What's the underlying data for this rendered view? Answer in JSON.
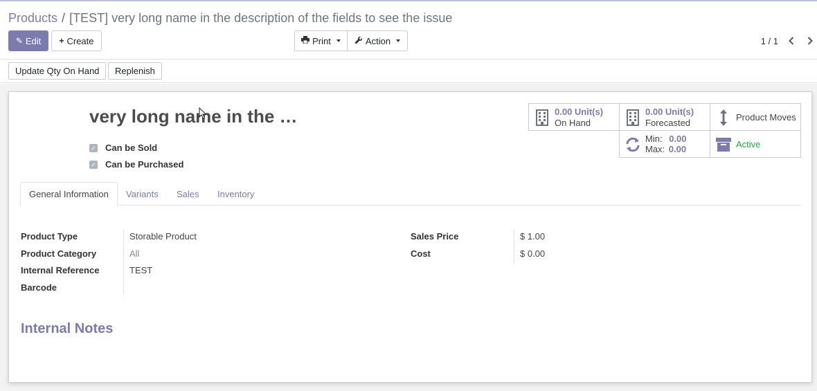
{
  "breadcrumb": {
    "parent": "Products",
    "separator": "/",
    "current": "[TEST] very long name in the description of the fields to see the issue"
  },
  "toolbar": {
    "edit_label": "Edit",
    "create_label": "Create",
    "print_label": "Print",
    "action_label": "Action"
  },
  "pager": {
    "value": "1 / 1"
  },
  "statusbar": {
    "update_qty_label": "Update Qty On Hand",
    "replenish_label": "Replenish"
  },
  "product": {
    "name": "very long name in the …",
    "can_be_sold": "Can be Sold",
    "can_be_purchased": "Can be Purchased"
  },
  "smart_buttons": {
    "on_hand": {
      "value": "0.00 Unit(s)",
      "label": "On Hand",
      "icon": "building-icon"
    },
    "forecasted": {
      "value": "0.00 Unit(s)",
      "label": "Forecasted",
      "icon": "building-icon"
    },
    "product_moves": {
      "label": "Product Moves",
      "icon": "arrows-v-icon"
    },
    "reorder": {
      "min_label": "Min:",
      "min_value": "0.00",
      "max_label": "Max:",
      "max_value": "0.00",
      "icon": "refresh-icon"
    },
    "active": {
      "label": "Active",
      "icon": "archive-icon"
    }
  },
  "tabs": [
    "General Information",
    "Variants",
    "Sales",
    "Inventory"
  ],
  "fields_left": [
    {
      "label": "Product Type",
      "value": "Storable Product"
    },
    {
      "label": "Product Category",
      "value": "All"
    },
    {
      "label": "Internal Reference",
      "value": "TEST"
    },
    {
      "label": "Barcode",
      "value": ""
    }
  ],
  "fields_right": [
    {
      "label": "Sales Price",
      "value": "$ 1.00"
    },
    {
      "label": "Cost",
      "value": "$ 0.00"
    }
  ],
  "notes_heading": "Internal Notes",
  "colors": {
    "accent": "#7c7bad",
    "active": "#28a745"
  }
}
